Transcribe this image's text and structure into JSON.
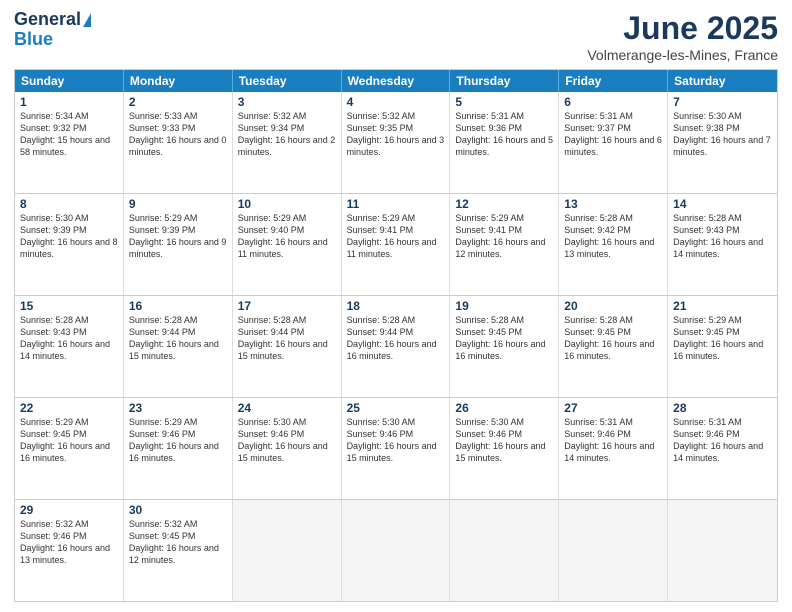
{
  "header": {
    "logo_general": "General",
    "logo_blue": "Blue",
    "month_title": "June 2025",
    "location": "Volmerange-les-Mines, France"
  },
  "days_of_week": [
    "Sunday",
    "Monday",
    "Tuesday",
    "Wednesday",
    "Thursday",
    "Friday",
    "Saturday"
  ],
  "weeks": [
    [
      {
        "day": "1",
        "sunrise": "5:34 AM",
        "sunset": "9:32 PM",
        "daylight": "15 hours and 58 minutes"
      },
      {
        "day": "2",
        "sunrise": "5:33 AM",
        "sunset": "9:33 PM",
        "daylight": "16 hours and 0 minutes"
      },
      {
        "day": "3",
        "sunrise": "5:32 AM",
        "sunset": "9:34 PM",
        "daylight": "16 hours and 2 minutes"
      },
      {
        "day": "4",
        "sunrise": "5:32 AM",
        "sunset": "9:35 PM",
        "daylight": "16 hours and 3 minutes"
      },
      {
        "day": "5",
        "sunrise": "5:31 AM",
        "sunset": "9:36 PM",
        "daylight": "16 hours and 5 minutes"
      },
      {
        "day": "6",
        "sunrise": "5:31 AM",
        "sunset": "9:37 PM",
        "daylight": "16 hours and 6 minutes"
      },
      {
        "day": "7",
        "sunrise": "5:30 AM",
        "sunset": "9:38 PM",
        "daylight": "16 hours and 7 minutes"
      }
    ],
    [
      {
        "day": "8",
        "sunrise": "5:30 AM",
        "sunset": "9:39 PM",
        "daylight": "16 hours and 8 minutes"
      },
      {
        "day": "9",
        "sunrise": "5:29 AM",
        "sunset": "9:39 PM",
        "daylight": "16 hours and 9 minutes"
      },
      {
        "day": "10",
        "sunrise": "5:29 AM",
        "sunset": "9:40 PM",
        "daylight": "16 hours and 11 minutes"
      },
      {
        "day": "11",
        "sunrise": "5:29 AM",
        "sunset": "9:41 PM",
        "daylight": "16 hours and 11 minutes"
      },
      {
        "day": "12",
        "sunrise": "5:29 AM",
        "sunset": "9:41 PM",
        "daylight": "16 hours and 12 minutes"
      },
      {
        "day": "13",
        "sunrise": "5:28 AM",
        "sunset": "9:42 PM",
        "daylight": "16 hours and 13 minutes"
      },
      {
        "day": "14",
        "sunrise": "5:28 AM",
        "sunset": "9:43 PM",
        "daylight": "16 hours and 14 minutes"
      }
    ],
    [
      {
        "day": "15",
        "sunrise": "5:28 AM",
        "sunset": "9:43 PM",
        "daylight": "16 hours and 14 minutes"
      },
      {
        "day": "16",
        "sunrise": "5:28 AM",
        "sunset": "9:44 PM",
        "daylight": "16 hours and 15 minutes"
      },
      {
        "day": "17",
        "sunrise": "5:28 AM",
        "sunset": "9:44 PM",
        "daylight": "16 hours and 15 minutes"
      },
      {
        "day": "18",
        "sunrise": "5:28 AM",
        "sunset": "9:44 PM",
        "daylight": "16 hours and 16 minutes"
      },
      {
        "day": "19",
        "sunrise": "5:28 AM",
        "sunset": "9:45 PM",
        "daylight": "16 hours and 16 minutes"
      },
      {
        "day": "20",
        "sunrise": "5:28 AM",
        "sunset": "9:45 PM",
        "daylight": "16 hours and 16 minutes"
      },
      {
        "day": "21",
        "sunrise": "5:29 AM",
        "sunset": "9:45 PM",
        "daylight": "16 hours and 16 minutes"
      }
    ],
    [
      {
        "day": "22",
        "sunrise": "5:29 AM",
        "sunset": "9:45 PM",
        "daylight": "16 hours and 16 minutes"
      },
      {
        "day": "23",
        "sunrise": "5:29 AM",
        "sunset": "9:46 PM",
        "daylight": "16 hours and 16 minutes"
      },
      {
        "day": "24",
        "sunrise": "5:30 AM",
        "sunset": "9:46 PM",
        "daylight": "16 hours and 15 minutes"
      },
      {
        "day": "25",
        "sunrise": "5:30 AM",
        "sunset": "9:46 PM",
        "daylight": "16 hours and 15 minutes"
      },
      {
        "day": "26",
        "sunrise": "5:30 AM",
        "sunset": "9:46 PM",
        "daylight": "16 hours and 15 minutes"
      },
      {
        "day": "27",
        "sunrise": "5:31 AM",
        "sunset": "9:46 PM",
        "daylight": "16 hours and 14 minutes"
      },
      {
        "day": "28",
        "sunrise": "5:31 AM",
        "sunset": "9:46 PM",
        "daylight": "16 hours and 14 minutes"
      }
    ],
    [
      {
        "day": "29",
        "sunrise": "5:32 AM",
        "sunset": "9:46 PM",
        "daylight": "16 hours and 13 minutes"
      },
      {
        "day": "30",
        "sunrise": "5:32 AM",
        "sunset": "9:45 PM",
        "daylight": "16 hours and 12 minutes"
      },
      null,
      null,
      null,
      null,
      null
    ]
  ]
}
